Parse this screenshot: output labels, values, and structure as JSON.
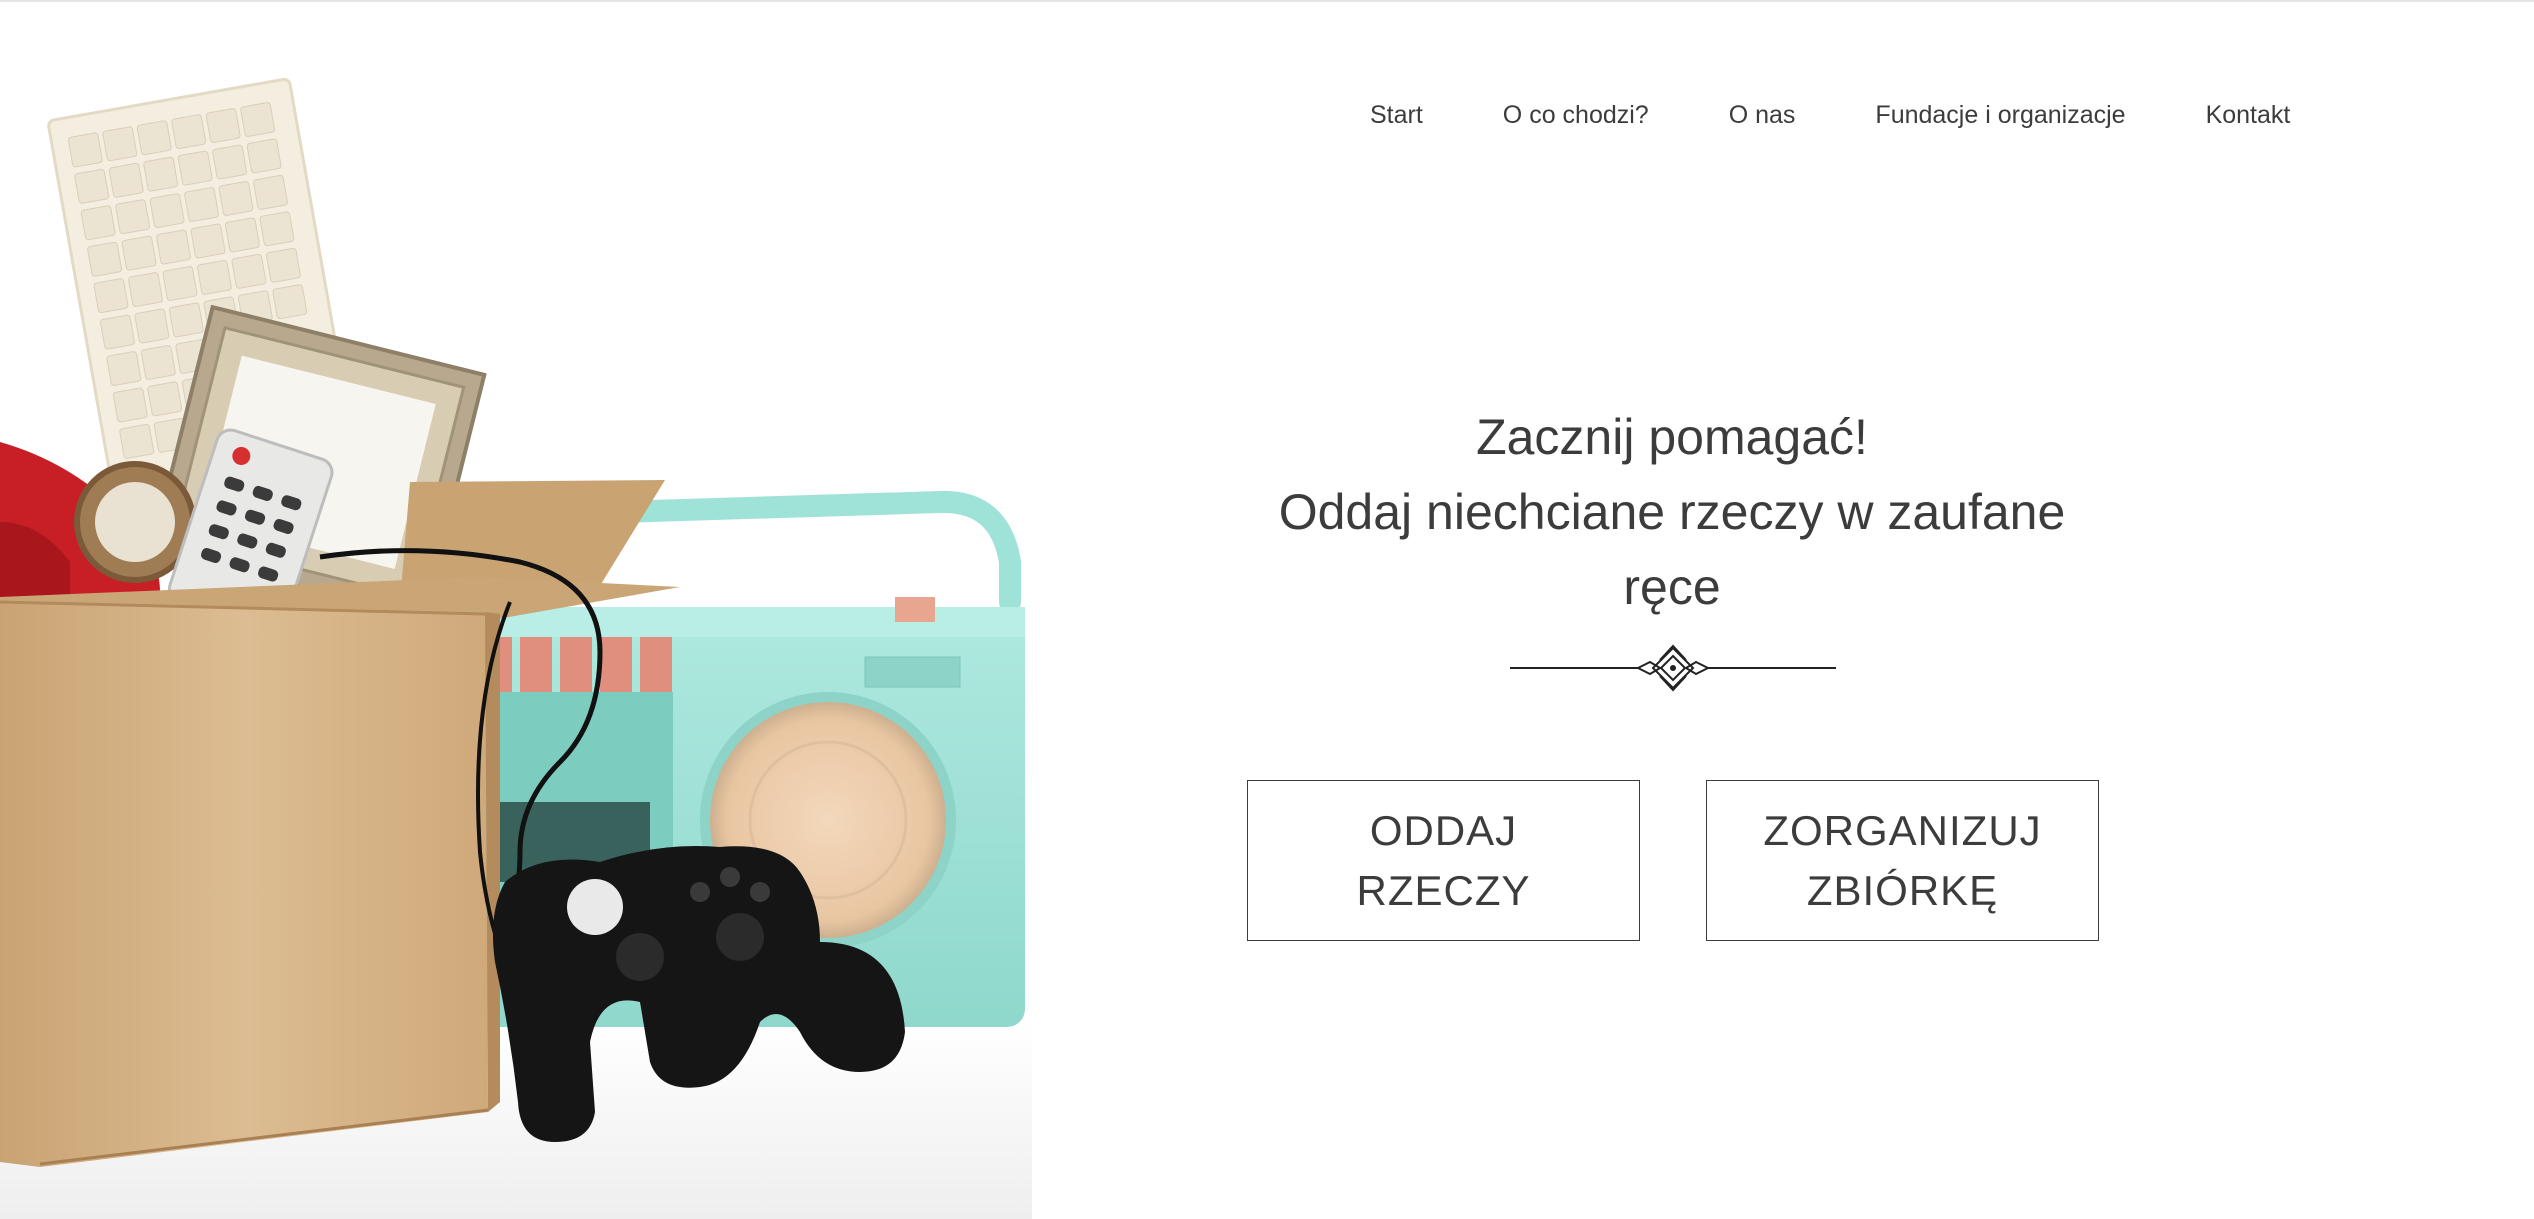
{
  "nav": {
    "items": [
      {
        "label": "Start"
      },
      {
        "label": "O co chodzi?"
      },
      {
        "label": "O nas"
      },
      {
        "label": "Fundacje i organizacje"
      },
      {
        "label": "Kontakt"
      }
    ]
  },
  "hero": {
    "headline_line1": "Zacznij pomagać!",
    "headline_line2": "Oddaj niechciane rzeczy w zaufane",
    "headline_line3": "ręce",
    "buttons": {
      "give": {
        "line1": "ODDAJ",
        "line2": "RZECZY"
      },
      "organize": {
        "line1": "ZORGANIZUJ",
        "line2": "ZBIÓRKĘ"
      }
    }
  },
  "image": {
    "description_icons": [
      "cardboard-box",
      "keyboard",
      "picture-frame",
      "remote-control",
      "red-telephone",
      "mint-radio",
      "gamepad"
    ]
  },
  "colors": {
    "text": "#3c3c3c",
    "box": "#d7b68a",
    "radio": "#9fe3d8",
    "telephone": "#c81e25",
    "speaker": "#f0cfae",
    "gamepad": "#111111"
  }
}
